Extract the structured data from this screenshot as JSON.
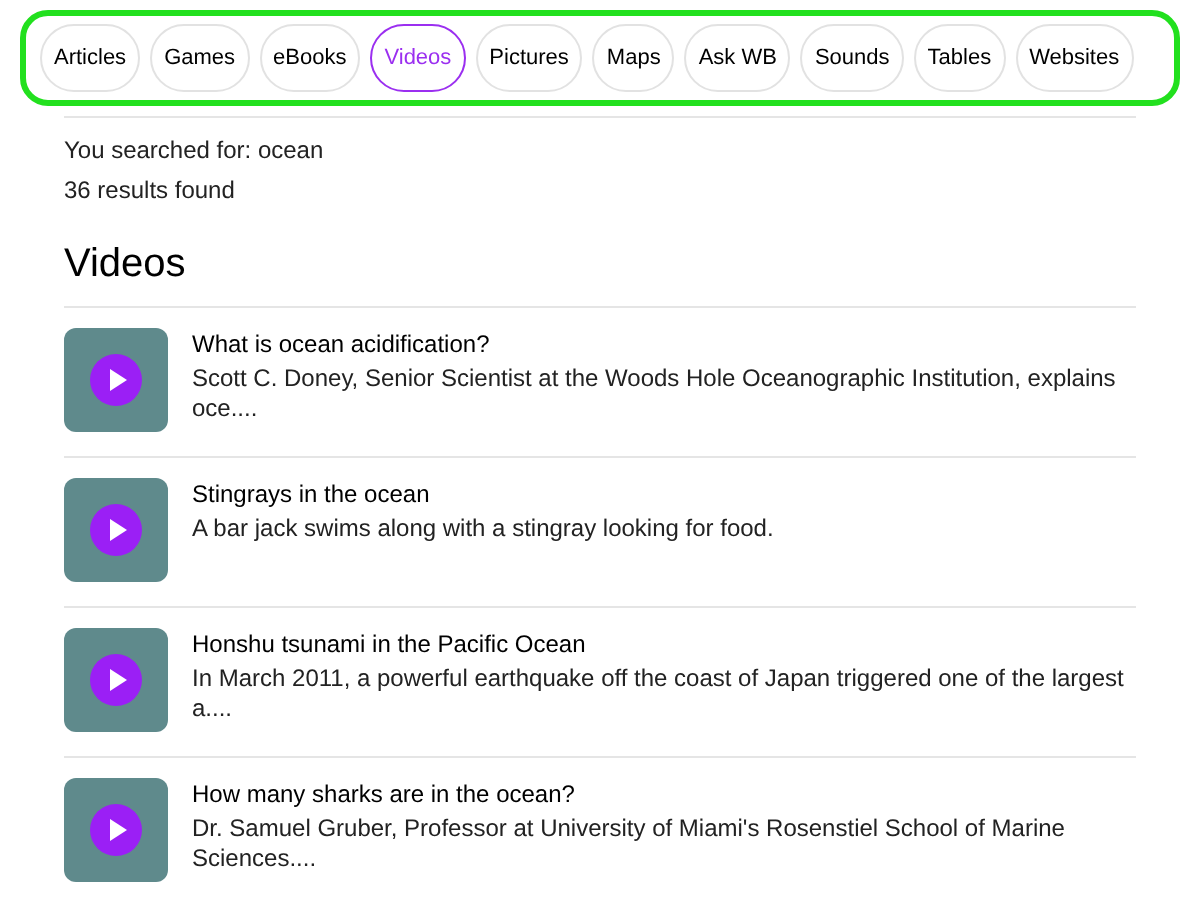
{
  "tabs": [
    {
      "label": "Articles",
      "selected": false
    },
    {
      "label": "Games",
      "selected": false
    },
    {
      "label": "eBooks",
      "selected": false
    },
    {
      "label": "Videos",
      "selected": true
    },
    {
      "label": "Pictures",
      "selected": false
    },
    {
      "label": "Maps",
      "selected": false
    },
    {
      "label": "Ask WB",
      "selected": false
    },
    {
      "label": "Sounds",
      "selected": false
    },
    {
      "label": "Tables",
      "selected": false
    },
    {
      "label": "Websites",
      "selected": false
    }
  ],
  "search_summary": {
    "query_line": "You searched for: ocean",
    "count_line": "36 results found"
  },
  "section_title": "Videos",
  "results": [
    {
      "title": "What is ocean acidification?",
      "description": "Scott C. Doney, Senior Scientist at the Woods Hole Oceanographic Institution, explains oce...."
    },
    {
      "title": "Stingrays in the ocean",
      "description": "A bar jack swims along with a stingray looking for food."
    },
    {
      "title": "Honshu tsunami in the Pacific Ocean",
      "description": "In March 2011, a powerful earthquake off the coast of Japan triggered one of the largest a...."
    },
    {
      "title": "How many sharks are in the ocean?",
      "description": "Dr. Samuel Gruber, Professor at University of Miami's Rosenstiel School of Marine Sciences...."
    }
  ]
}
